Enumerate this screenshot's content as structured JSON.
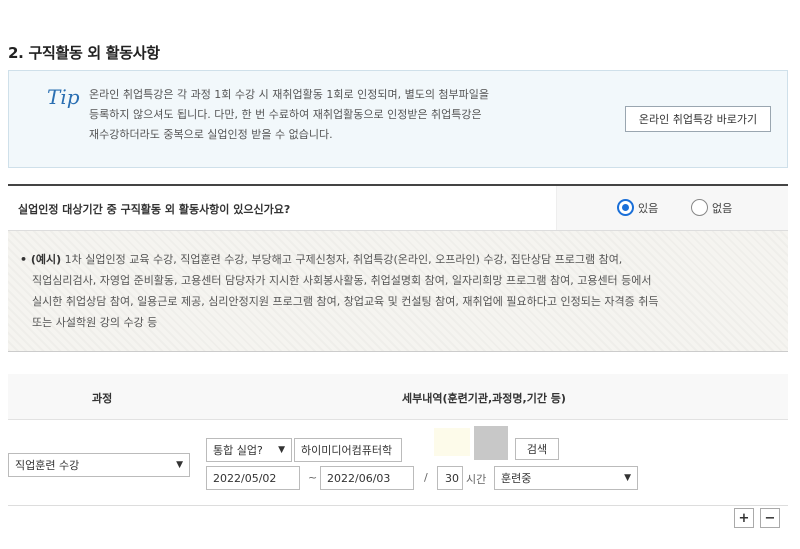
{
  "section": {
    "title": "2. 구직활동 외 활동사항"
  },
  "tip": {
    "logo": "Tip",
    "lines": [
      "온라인 취업특강은 각 과정 1회 수강 시 재취업활동 1회로 인정되며, 별도의 첨부파일을",
      "등록하지 않으셔도 됩니다. 다만, 한 번 수료하여 재취업활동으로 인정받은 취업특강은",
      "재수강하더라도 중복으로 실업인정 받을 수 없습니다."
    ],
    "button_label": "온라인 취업특강 바로가기"
  },
  "question": {
    "label": "실업인정 대상기간 중 구직활동 외 활동사항이 있으신가요?",
    "options": [
      {
        "label": "있음",
        "checked": true
      },
      {
        "label": "없음",
        "checked": false
      }
    ]
  },
  "example": {
    "prefix": "• (예시)",
    "lines": [
      " 1차 실업인정 교육 수강, 직업훈련 수강, 부당해고 구제신청자, 취업특강(온라인, 오프라인) 수강, 집단상담 프로그램 참여,",
      "직업심리검사, 자영업 준비활동, 고용센터 담당자가 지시한 사회봉사활동, 취업설명회 참여, 일자리희망 프로그램 참여, 고용센터 등에서",
      "실시한 취업상담 참여, 일용근로 제공, 심리안정지원 프로그램 참여, 창업교육 및 컨설팅 참여, 재취업에 필요하다고 인정되는 자격증 취득",
      "또는 사설학원 강의 수강 등"
    ]
  },
  "table": {
    "headers": {
      "course": "과정",
      "detail": "세부내역(훈련기관,과정명,기간 등)"
    },
    "row": {
      "course": "직업훈련 수강",
      "institution_type": "통합 실업?",
      "institution_name": "하이미디어컴퓨터학",
      "search_label": "검색",
      "start_date": "2022/05/02",
      "range_sep": "~",
      "end_date": "2022/06/03",
      "slash": "/",
      "hours": "30",
      "hours_unit": "시간",
      "status": "훈련중"
    }
  },
  "actions": {
    "add": "+",
    "remove": "−"
  }
}
